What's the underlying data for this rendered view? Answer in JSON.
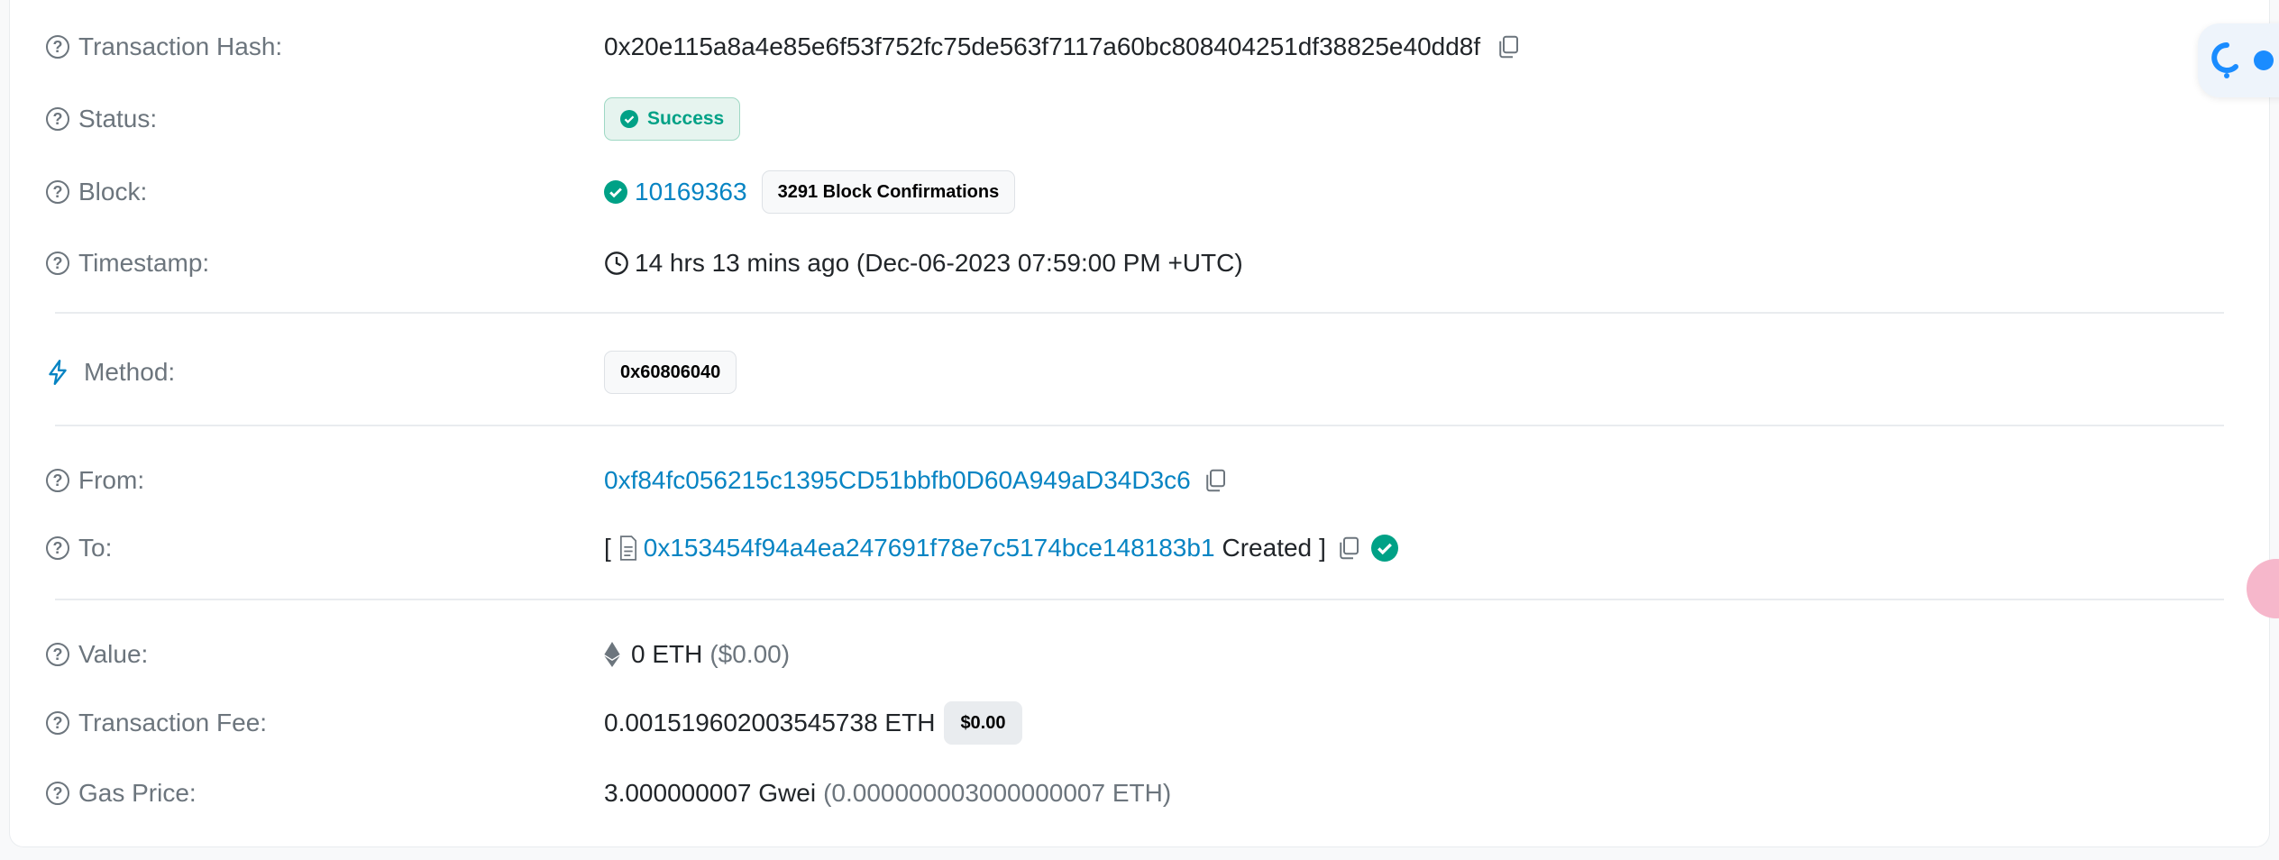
{
  "rows": {
    "tx_hash": {
      "label": "Transaction Hash:",
      "value": "0x20e115a8a4e85e6f53f752fc75de563f7117a60bc808404251df38825e40dd8f"
    },
    "status": {
      "label": "Status:",
      "value": "Success"
    },
    "block": {
      "label": "Block:",
      "number": "10169363",
      "confirmations": "3291 Block Confirmations"
    },
    "timestamp": {
      "label": "Timestamp:",
      "value": "14 hrs 13 mins ago (Dec-06-2023 07:59:00 PM +UTC)"
    },
    "method": {
      "label": "Method:",
      "value": "0x60806040"
    },
    "from": {
      "label": "From:",
      "address": "0xf84fc056215c1395CD51bbfb0D60A949aD34D3c6"
    },
    "to": {
      "label": "To:",
      "open_bracket": "[",
      "address": "0x153454f94a4ea247691f78e7c5174bce148183b1",
      "created": "Created",
      "close_bracket": "]"
    },
    "value": {
      "label": "Value:",
      "amount": "0 ETH",
      "usd": "($0.00)"
    },
    "fee": {
      "label": "Transaction Fee:",
      "amount": "0.001519602003545738 ETH",
      "usd_badge": "$0.00"
    },
    "gas": {
      "label": "Gas Price:",
      "amount": "3.000000007 Gwei",
      "eth": "(0.000000003000000007 ETH)"
    }
  },
  "colors": {
    "link": "#0784c3",
    "success": "#00a186",
    "muted": "#6c757d"
  },
  "icons": [
    "question-icon",
    "copy-icon",
    "check-circle-icon",
    "clock-icon",
    "lightning-icon",
    "contract-file-icon",
    "ethereum-icon"
  ]
}
